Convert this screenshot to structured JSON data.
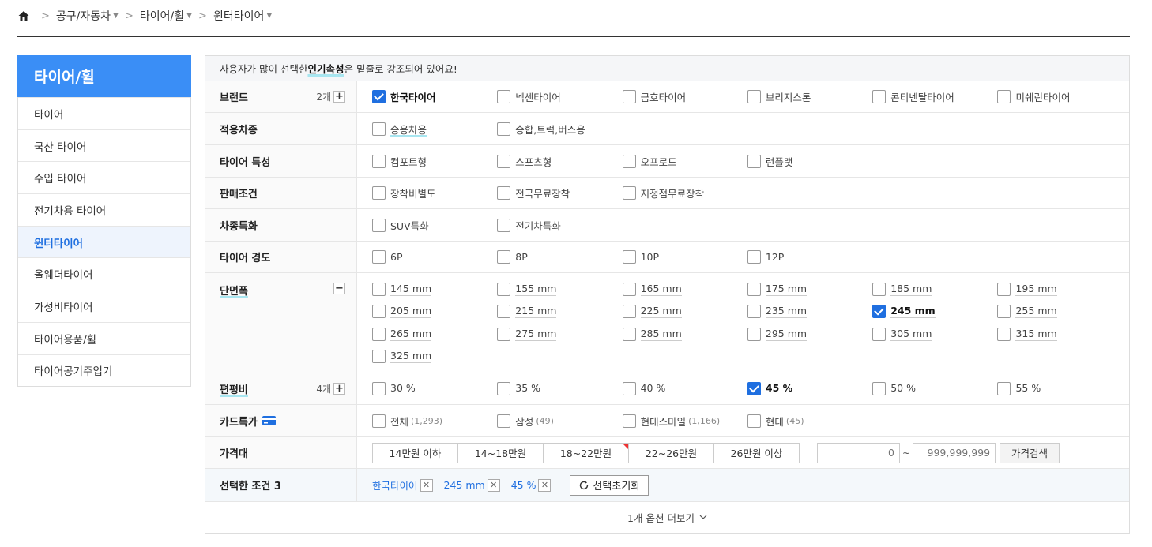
{
  "breadcrumb": {
    "items": [
      {
        "label": "공구/자동차"
      },
      {
        "label": "타이어/휠"
      },
      {
        "label": "윈터타이어"
      }
    ]
  },
  "sidebar": {
    "title": "타이어/휠",
    "items": [
      {
        "label": "타이어"
      },
      {
        "label": "국산 타이어"
      },
      {
        "label": "수입 타이어"
      },
      {
        "label": "전기차용 타이어"
      },
      {
        "label": "윈터타이어",
        "active": true
      },
      {
        "label": "올웨더타이어"
      },
      {
        "label": "가성비타이어"
      },
      {
        "label": "타이어용품/휠"
      },
      {
        "label": "타이어공기주입기"
      }
    ]
  },
  "notice": {
    "prefix": "사용자가 많이 선택한 ",
    "highlight": "인기속성",
    "suffix": "은 밑줄로 강조되어 있어요!"
  },
  "filters": {
    "brand": {
      "label": "브랜드",
      "count": "2개",
      "options": [
        {
          "label": "한국타이어",
          "checked": true
        },
        {
          "label": "넥센타이어"
        },
        {
          "label": "금호타이어"
        },
        {
          "label": "브리지스톤"
        },
        {
          "label": "콘티넨탈타이어"
        },
        {
          "label": "미쉐린타이어"
        }
      ]
    },
    "vehicle": {
      "label": "적용차종",
      "options": [
        {
          "label": "승용차용",
          "popular": true
        },
        {
          "label": "승합,트럭,버스용"
        }
      ]
    },
    "feature": {
      "label": "타이어 특성",
      "options": [
        {
          "label": "컴포트형"
        },
        {
          "label": "스포츠형"
        },
        {
          "label": "오프로드"
        },
        {
          "label": "런플랫"
        }
      ]
    },
    "sale": {
      "label": "판매조건",
      "options": [
        {
          "label": "장착비별도"
        },
        {
          "label": "전국무료장착"
        },
        {
          "label": "지정점무료장착"
        }
      ]
    },
    "special": {
      "label": "차종특화",
      "options": [
        {
          "label": "SUV특화"
        },
        {
          "label": "전기차특화"
        }
      ]
    },
    "hardness": {
      "label": "타이어 경도",
      "options": [
        {
          "label": "6P"
        },
        {
          "label": "8P"
        },
        {
          "label": "10P"
        },
        {
          "label": "12P"
        }
      ]
    },
    "width": {
      "label": "단면폭",
      "options": [
        {
          "label": "145 mm"
        },
        {
          "label": "155 mm"
        },
        {
          "label": "165 mm"
        },
        {
          "label": "175 mm"
        },
        {
          "label": "185 mm"
        },
        {
          "label": "195 mm"
        },
        {
          "label": "205 mm"
        },
        {
          "label": "215 mm"
        },
        {
          "label": "225 mm"
        },
        {
          "label": "235 mm"
        },
        {
          "label": "245 mm",
          "checked": true
        },
        {
          "label": "255 mm"
        },
        {
          "label": "265 mm"
        },
        {
          "label": "275 mm"
        },
        {
          "label": "285 mm"
        },
        {
          "label": "295 mm"
        },
        {
          "label": "305 mm"
        },
        {
          "label": "315 mm"
        },
        {
          "label": "325 mm"
        }
      ]
    },
    "aspect": {
      "label": "편평비",
      "count": "4개",
      "options": [
        {
          "label": "30 %"
        },
        {
          "label": "35 %"
        },
        {
          "label": "40 %"
        },
        {
          "label": "45 %",
          "checked": true
        },
        {
          "label": "50 %"
        },
        {
          "label": "55 %"
        }
      ]
    },
    "card": {
      "label": "카드특가",
      "options": [
        {
          "label": "전체",
          "count": "(1,293)"
        },
        {
          "label": "삼성",
          "count": "(49)"
        },
        {
          "label": "현대스마일",
          "count": "(1,166)"
        },
        {
          "label": "현대",
          "count": "(45)"
        }
      ]
    },
    "price": {
      "label": "가격대",
      "ranges": [
        "14만원 이하",
        "14~18만원",
        "18~22만원",
        "22~26만원",
        "26만원 이상"
      ],
      "min_placeholder": "0",
      "max_placeholder": "999,999,999",
      "tilde": "~",
      "search_label": "가격검색"
    },
    "selected": {
      "label": "선택한 조건 3",
      "chips": [
        "한국타이어",
        "245 mm",
        "45 %"
      ],
      "reset_label": "선택초기화"
    }
  },
  "more_label": "1개 옵션 더보기",
  "colors": {
    "accent": "#3a8ef6",
    "active_text": "#1f6fe0",
    "popular_underline": "#a8e6f0"
  }
}
